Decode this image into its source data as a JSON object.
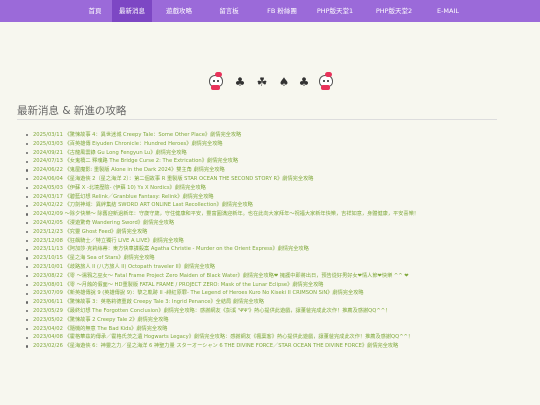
{
  "nav": [
    {
      "label": "首頁",
      "active": false
    },
    {
      "label": "最新消息",
      "active": true
    },
    {
      "label": "遊戲攻略",
      "active": false
    },
    {
      "label": "留言板",
      "active": false
    },
    {
      "label": "FB 粉絲團",
      "active": false
    },
    {
      "label": "PHP版天堂1",
      "active": false
    },
    {
      "label": "PHP版天堂2",
      "active": false
    },
    {
      "label": "E-MAIL",
      "active": false
    }
  ],
  "section": {
    "title": "最新消息 & 新進の攻略"
  },
  "news": [
    {
      "date": "2025/03/11",
      "title": "《驚悚故事 4：異世迷城 Creepy Tale：Some Other Place》劇情完全攻略"
    },
    {
      "date": "2025/03/03",
      "title": "《百英雄傳 Eiyuden Chronicle：Hundred Heroes》劇情完全攻略"
    },
    {
      "date": "2024/09/21",
      "title": "《古龍風雲錄 Gu Long Fengyun Lu》劇情完全攻略"
    },
    {
      "date": "2024/07/13",
      "title": "《女鬼橋二 釋魂路 The Bridge Curse 2: The Extrication》劇情完全攻略"
    },
    {
      "date": "2024/06/22",
      "title": "《鬼屋魔影: 重製版 Alone in the Dark 2024》雙主角 劇情完全攻略"
    },
    {
      "date": "2024/06/04",
      "title": "《星海遊俠 2（星之海洋 2）：第二個故事 R 重製版 STAR OCEAN THE SECOND STORY R》劇情完全攻略"
    },
    {
      "date": "2024/05/03",
      "title": "《伊蘇 X -北境歷險- (伊蘇 10) Ys X Nordics》劇情完全攻略"
    },
    {
      "date": "2024/03/17",
      "title": "《碧藍幻想 Relink／Granblue Fantasy: Relink》劇情完全攻略"
    },
    {
      "date": "2024/02/22",
      "title": "《刀劍神域：異絆集結 SWORD ART ONLINE Last Recollection》劇情完全攻略"
    },
    {
      "date": "2024/02/09",
      "title": "～除夕快樂～ 除舊迎新過新年：守歲守歲，守住健康和平安，豐富圓滿迎新年。也在此向大家拜年～祝福大家新年快樂，吉祥如意，身體健康，平安喜樂！"
    },
    {
      "date": "2024/02/05",
      "title": "《漫遊驚奇 Wandering Sword》劇情完全攻略"
    },
    {
      "date": "2023/12/23",
      "title": "《究靈 Ghost Feed》劇情完全攻略"
    },
    {
      "date": "2023/12/08",
      "title": "《狂飆騎士／特立獨行 LIVE A LIVE》劇情完全攻略"
    },
    {
      "date": "2023/11/13",
      "title": "《阿加莎·克莉絲蒂：東方快車謀殺案 Agatha Christie - Murder on the Orient Express》劇情完全攻略"
    },
    {
      "date": "2023/10/15",
      "title": "《星之海 Sea of Stars》劇情完全攻略"
    },
    {
      "date": "2023/10/01",
      "title": "《歧路旅人 II (八方旅人 II) Octopath traveler II》劇情完全攻略"
    },
    {
      "date": "2023/08/22",
      "title": "《零 ～濡鴉之巫女～ Fatal Frame Project Zero Maiden of Black Water》劇情完全攻略❤ 擁護中即將出日，預告從好男好女❤情人節❤快樂 ^^ ❤"
    },
    {
      "date": "2023/08/01",
      "title": "《零 ～月蝕的假面～ HD重製版 FATAL FRAME / PROJECT ZERO: Mask of the Lunar Eclipse》劇情完全攻略"
    },
    {
      "date": "2023/07/09",
      "title": "《新英雄傳說 9 (英雄傳說 9)：黎之軌跡 II -緋紅原罪- The Legend of Heroes Kuro No Kiseki II CRIMSON SiN》劇情完全攻略"
    },
    {
      "date": "2023/06/11",
      "title": "《驚悚故事 3：英格莉德重啟 Creepy Tale 3: Ingrid Penance》全結局 劇情完全攻略"
    },
    {
      "date": "2023/05/29",
      "title": "《最終幻想 The Forgotten Conclusion》劇情完全攻略：感謝網友《彭溪 'ΨΨ'》熱心提供此遊戲，讓董爸完成此次作！推薦及感謝QQ^^！"
    },
    {
      "date": "2023/05/02",
      "title": "《驚悚故事 2 Creepy Tale 2》劇情完全攻略"
    },
    {
      "date": "2023/04/02",
      "title": "《隨機的無意 The Bad Kids》劇情完全攻略"
    },
    {
      "date": "2023/04/08",
      "title": "《霍格華茲的傳承／霍格氏茨之遺 Hogwarts Legacy》劇情完全攻略：感謝網友《楓葉客》熱心提供此遊戲，讓董爸完成此次作！推薦及感謝QQ^^！"
    },
    {
      "date": "2023/02/26",
      "title": "《星海遊俠 6：神靈之力／星之海洋 6 神聖力量 スターオーシャン 6 THE DIVINE FORCE／STAR OCEAN THE DIVINE FORCE》劇情完全攻略"
    }
  ]
}
